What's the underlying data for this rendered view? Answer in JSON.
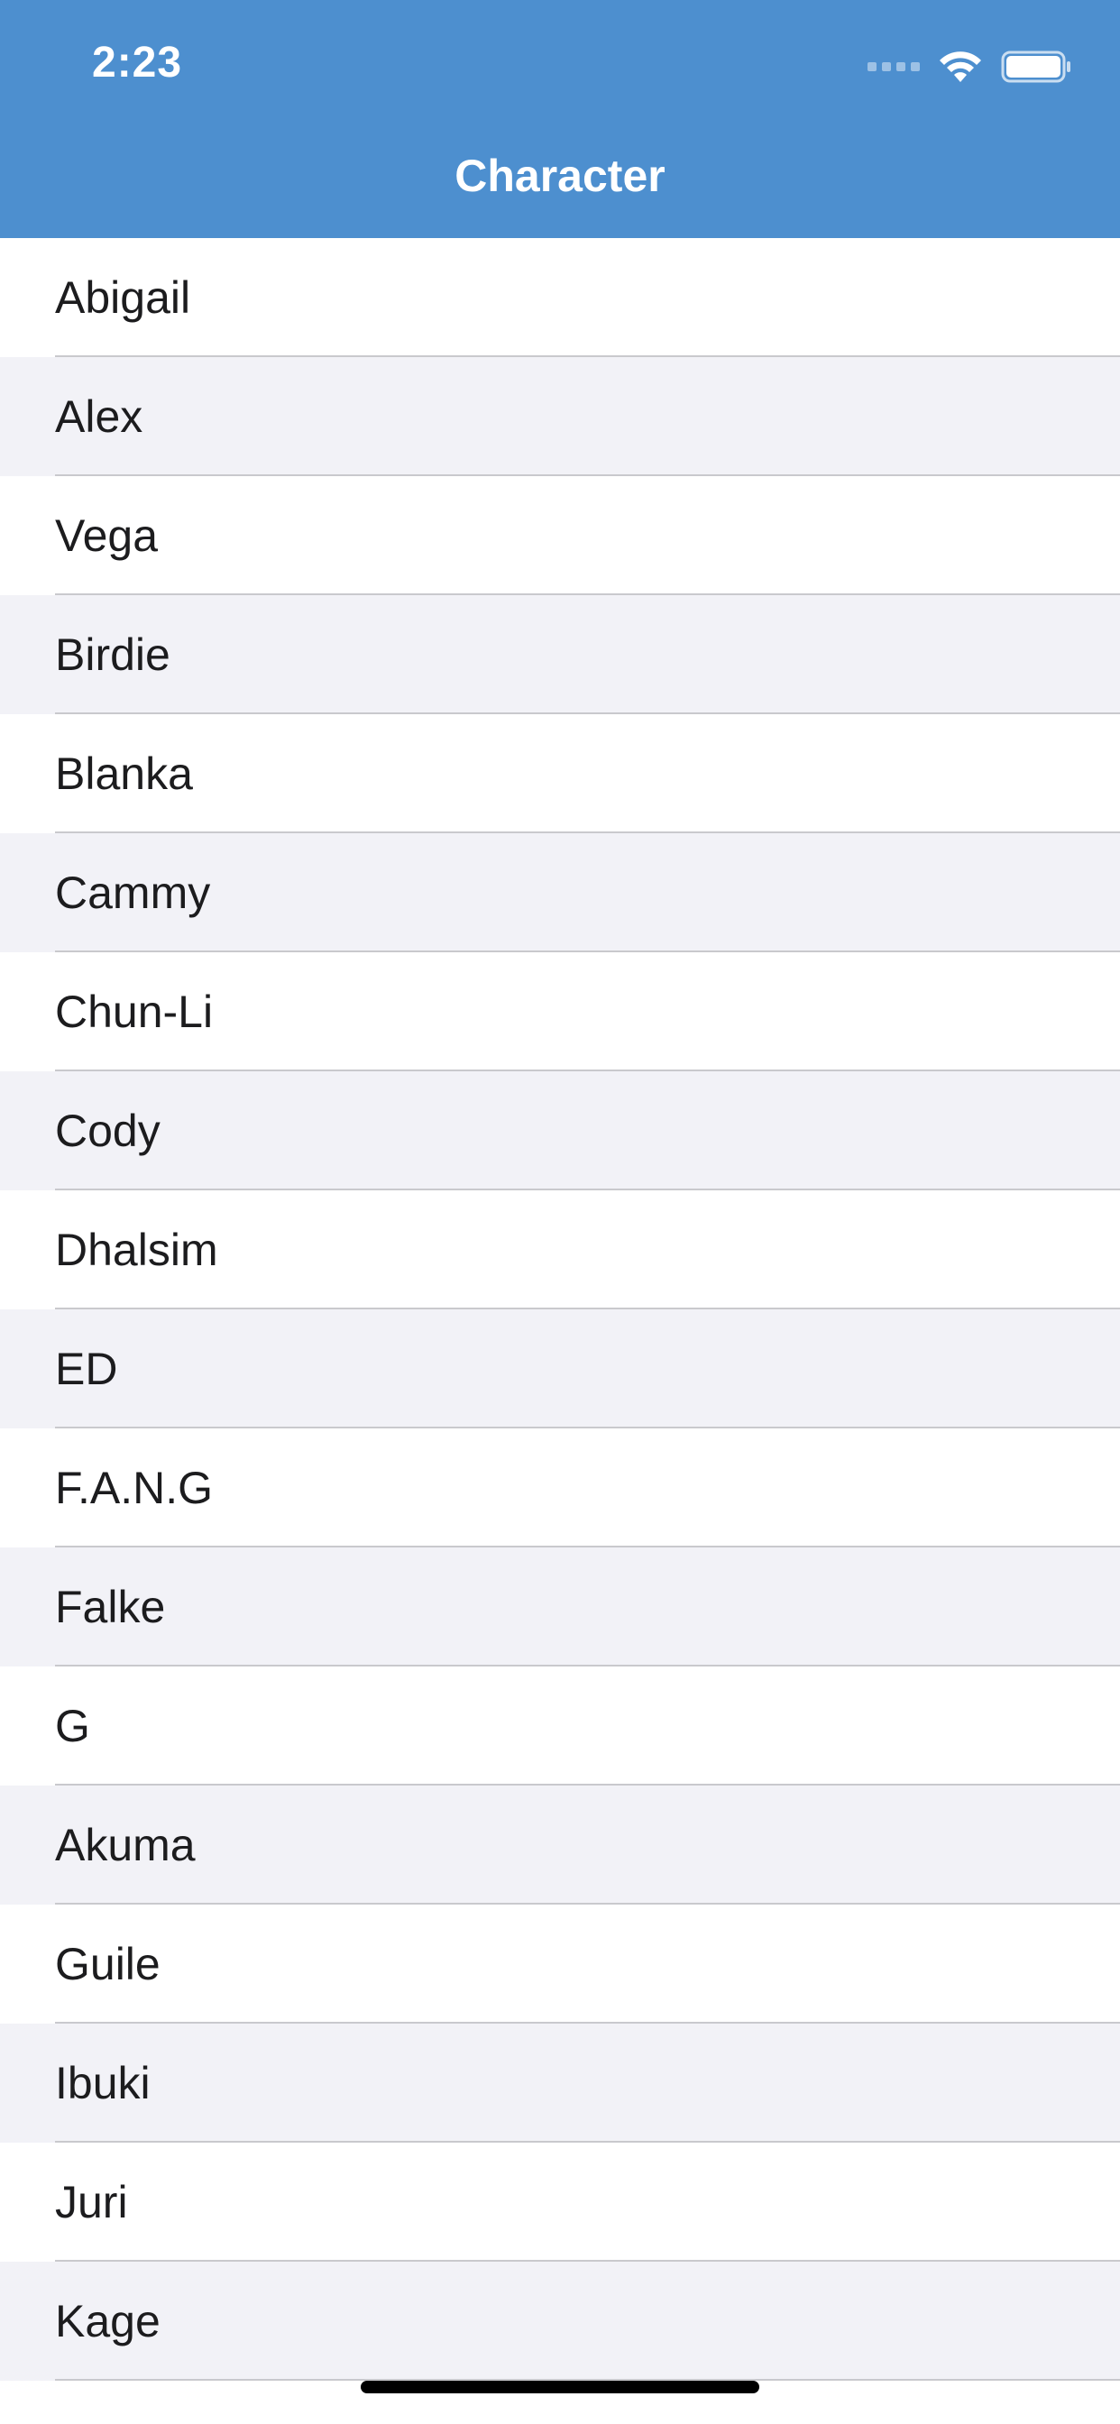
{
  "status_bar": {
    "time": "2:23"
  },
  "nav": {
    "title": "Character"
  },
  "colors": {
    "header": "#4d8fcf",
    "row_alt": "#f2f2f7",
    "separator": "#c9c9cd"
  },
  "characters": [
    "Abigail",
    "Alex",
    "Vega",
    "Birdie",
    "Blanka",
    "Cammy",
    "Chun-Li",
    "Cody",
    "Dhalsim",
    "ED",
    "F.A.N.G",
    "Falke",
    "G",
    "Akuma",
    "Guile",
    "Ibuki",
    "Juri",
    "Kage"
  ]
}
